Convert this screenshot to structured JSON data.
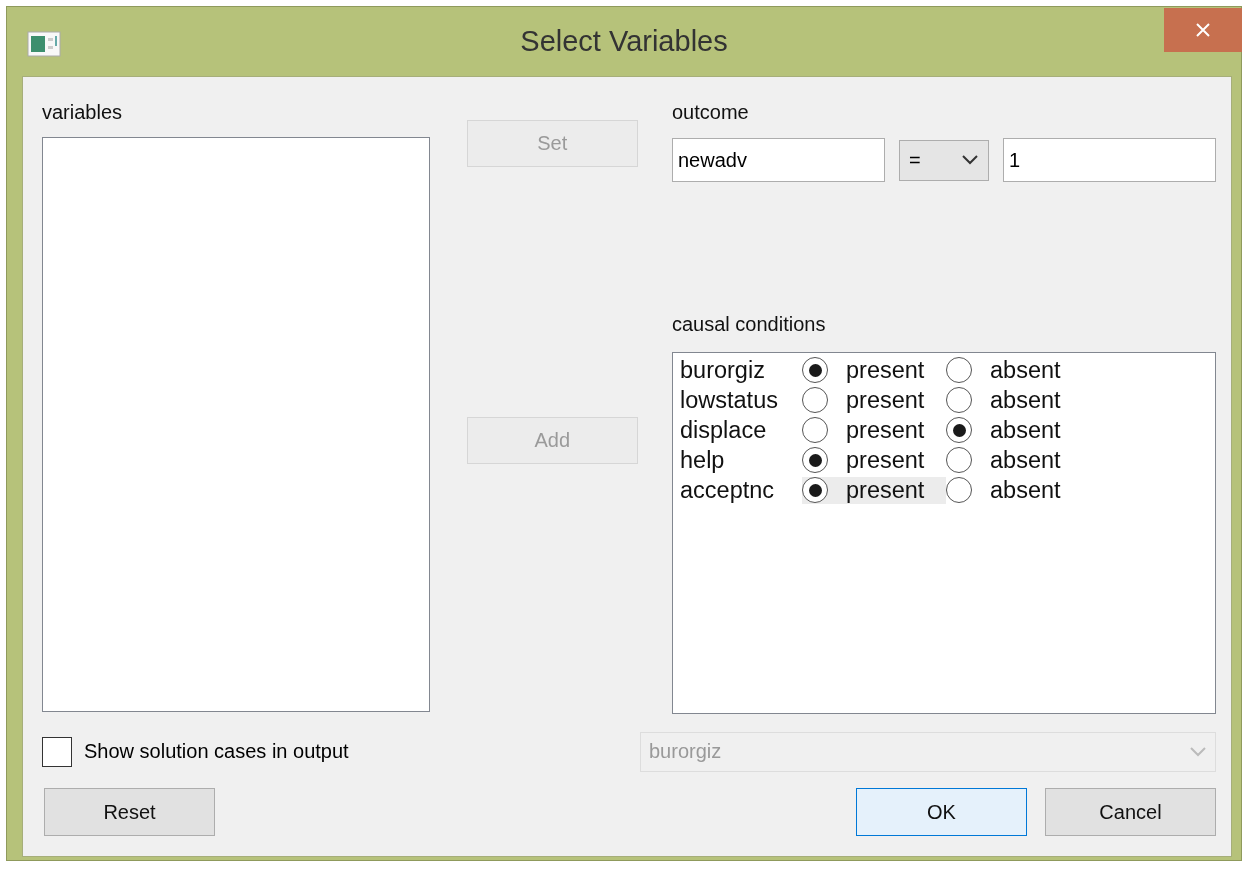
{
  "window": {
    "title": "Select Variables"
  },
  "variables": {
    "label": "variables"
  },
  "buttons": {
    "set": {
      "label": "Set",
      "disabled": true
    },
    "add": {
      "label": "Add",
      "disabled": true
    }
  },
  "outcome": {
    "label": "outcome",
    "variable": "newadv",
    "operator": "=",
    "value": "1"
  },
  "causal_conditions": {
    "label": "causal conditions",
    "rows": [
      {
        "name": "burorgiz",
        "options": [
          {
            "label": "present",
            "selected": true,
            "focused": false
          },
          {
            "label": "absent",
            "selected": false,
            "focused": false
          }
        ]
      },
      {
        "name": "lowstatus",
        "options": [
          {
            "label": "present",
            "selected": false,
            "focused": false
          },
          {
            "label": "absent",
            "selected": false,
            "focused": false
          }
        ]
      },
      {
        "name": "displace",
        "options": [
          {
            "label": "present",
            "selected": false,
            "focused": false
          },
          {
            "label": "absent",
            "selected": true,
            "focused": false
          }
        ]
      },
      {
        "name": "help",
        "options": [
          {
            "label": "present",
            "selected": true,
            "focused": false
          },
          {
            "label": "absent",
            "selected": false,
            "focused": false
          }
        ]
      },
      {
        "name": "acceptnc",
        "options": [
          {
            "label": "present",
            "selected": true,
            "focused": true
          },
          {
            "label": "absent",
            "selected": false,
            "focused": false
          }
        ]
      }
    ]
  },
  "show_cases": {
    "label": "Show solution cases in output",
    "checked": false
  },
  "condition_select": {
    "value": "burorgiz",
    "disabled": true
  },
  "footer": [
    {
      "label": "Reset",
      "default": false
    },
    {
      "label": "OK",
      "default": true
    },
    {
      "label": "Cancel",
      "default": false
    }
  ]
}
